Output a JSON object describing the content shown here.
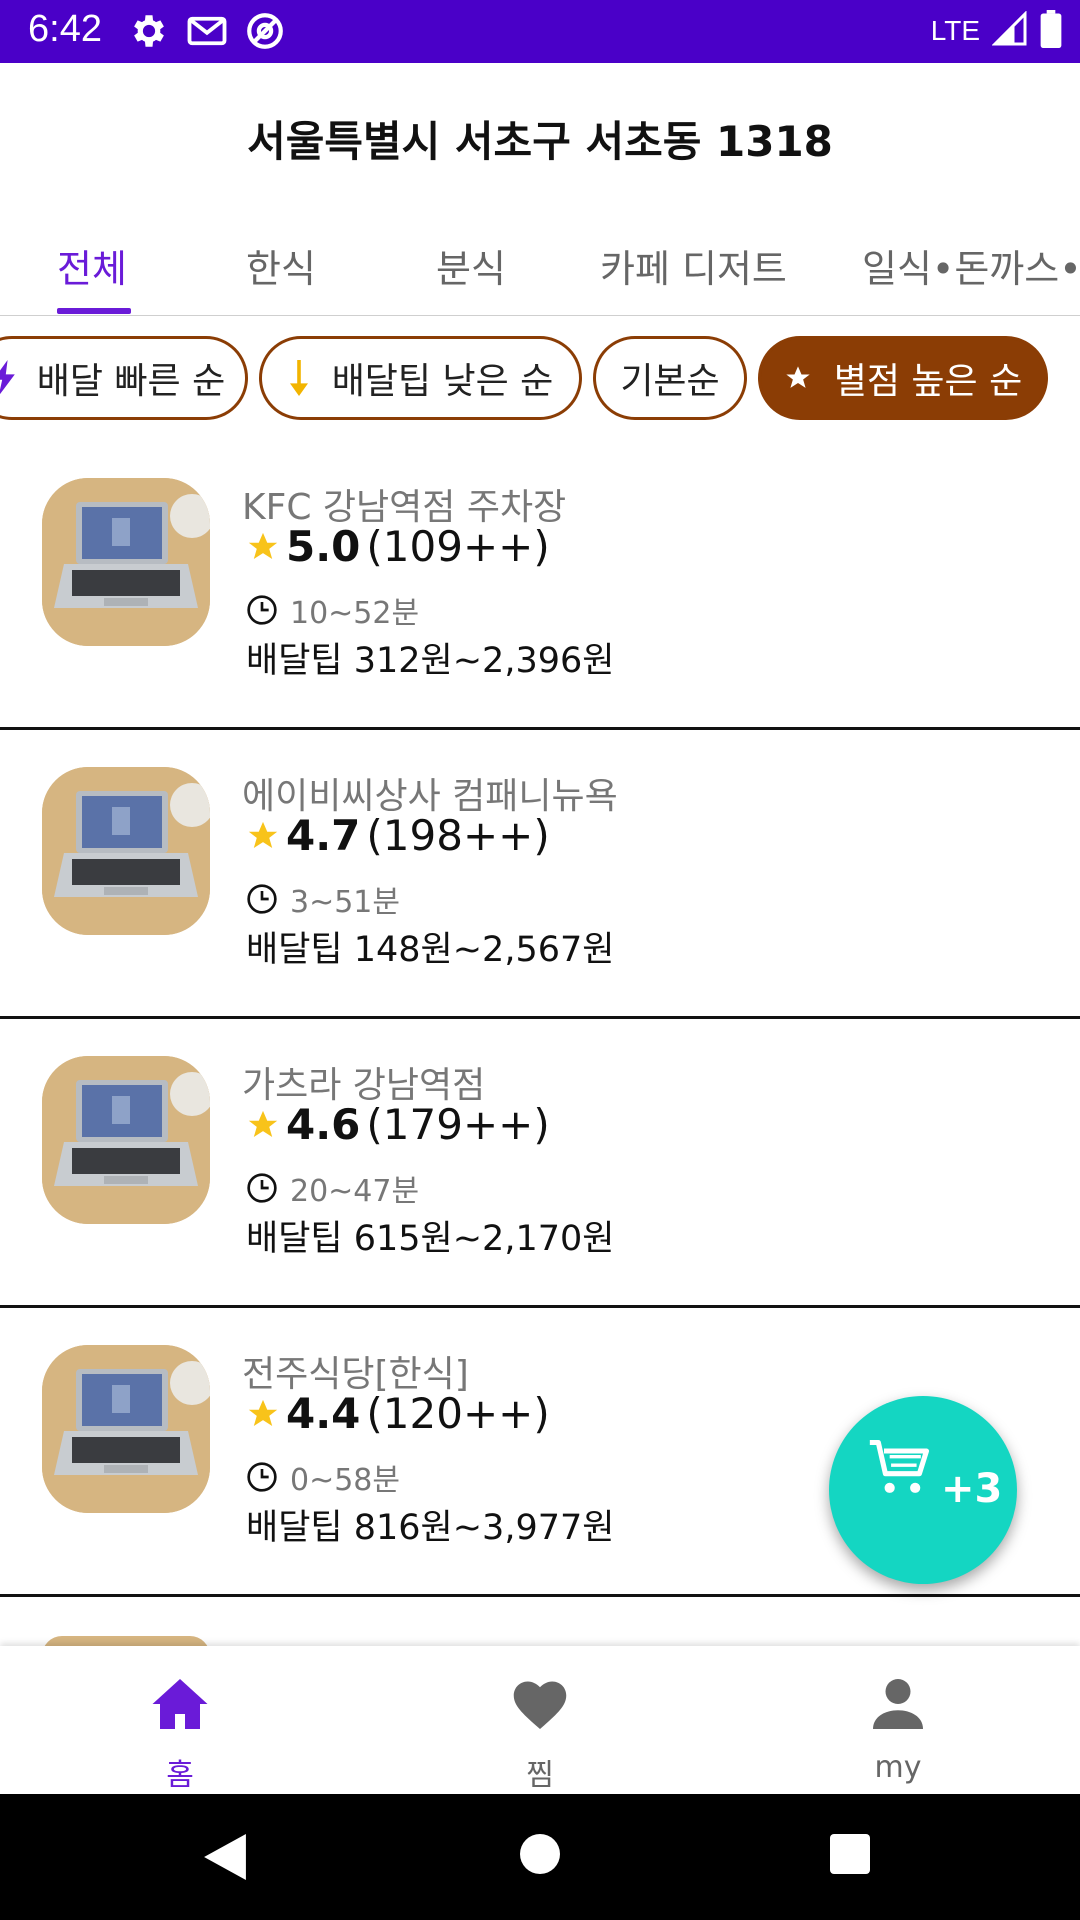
{
  "status_bar": {
    "time": "6:42",
    "network": "LTE",
    "icons": [
      "gear-icon",
      "mail-icon",
      "at-sign-icon",
      "signal-icon",
      "battery-icon"
    ]
  },
  "header": {
    "title": "서울특별시 서초구 서초동 1318"
  },
  "tabs": [
    {
      "label": "전체",
      "active": true
    },
    {
      "label": "한식"
    },
    {
      "label": "분식"
    },
    {
      "label": "카페 디저트"
    },
    {
      "label": "일식•돈까스•"
    }
  ],
  "filters": [
    {
      "label": "배달 빠른 순",
      "icon": "lightning-icon"
    },
    {
      "label": "배달팁 낮은 순",
      "icon": "down-arrow-icon"
    },
    {
      "label": "기본순"
    },
    {
      "label": "별점 높은 순",
      "icon": "star-icon",
      "active": true
    }
  ],
  "stores": [
    {
      "name": "KFC 강남역점 주차장",
      "rating": "5.0",
      "reviews": "(109++)",
      "time": "10~52분",
      "tip": "배달팁 312원~2,396원"
    },
    {
      "name": "에이비씨상사 컴패니뉴욕",
      "rating": "4.7",
      "reviews": "(198++)",
      "time": "3~51분",
      "tip": "배달팁 148원~2,567원"
    },
    {
      "name": "가츠라 강남역점",
      "rating": "4.6",
      "reviews": "(179++)",
      "time": "20~47분",
      "tip": "배달팁 615원~2,170원"
    },
    {
      "name": "전주식당[한식]",
      "rating": "4.4",
      "reviews": "(120++)",
      "time": "0~58분",
      "tip": "배달팁 816원~3,977원"
    }
  ],
  "cart": {
    "count": "+3"
  },
  "bottom_nav": [
    {
      "label": "홈",
      "icon": "home-icon",
      "active": true
    },
    {
      "label": "찜",
      "icon": "heart-icon"
    },
    {
      "label": "my",
      "icon": "person-icon"
    }
  ],
  "colors": {
    "status_bar": "#4a00c8",
    "accent": "#6a1bd8",
    "chip": "#8b3d05",
    "fab": "#14d6c2",
    "star": "#f8c31a"
  }
}
